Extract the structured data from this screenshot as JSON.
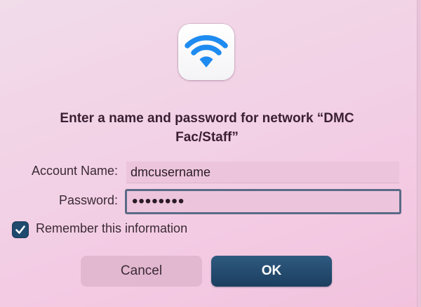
{
  "dialog": {
    "icon": "wifi-icon",
    "title_line1": "Enter a name and password for network “DMC",
    "title_line2": "Fac/Staff”"
  },
  "form": {
    "account_label": "Account Name:",
    "account_value": "dmcusername",
    "password_label": "Password:",
    "password_masked": "••••••••"
  },
  "remember": {
    "label": "Remember this information",
    "checked": true
  },
  "buttons": {
    "cancel": "Cancel",
    "ok": "OK"
  },
  "colors": {
    "wifi_blue": "#1e8bf0",
    "ok_button": "#244c70",
    "checkbox": "#1f4a6e"
  }
}
